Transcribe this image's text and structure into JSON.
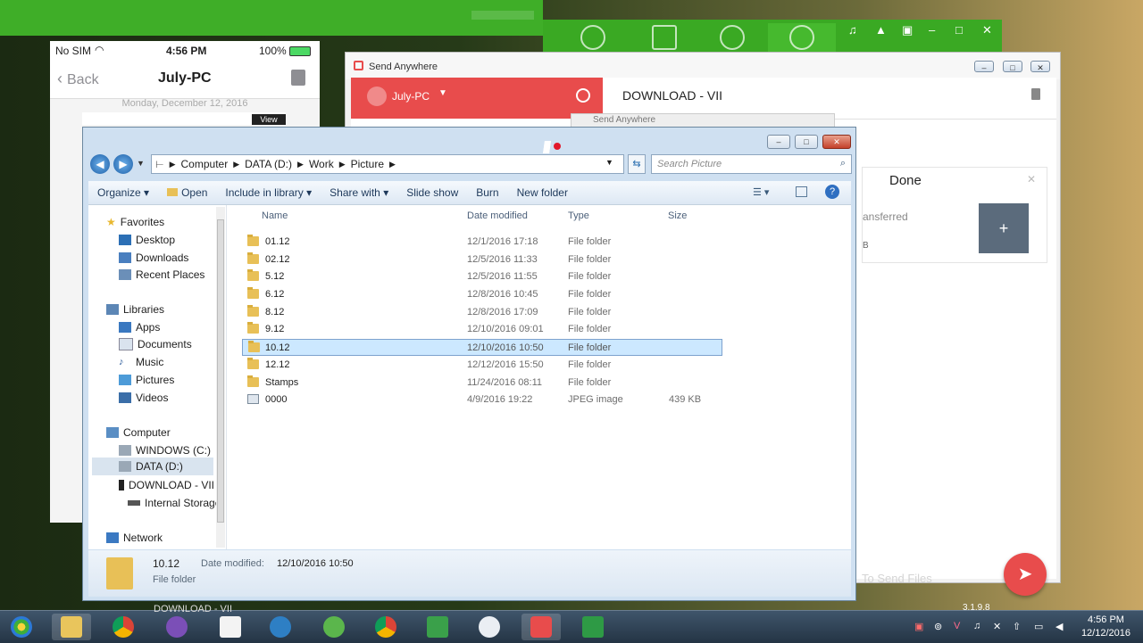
{
  "phone": {
    "carrier": "No SIM",
    "time": "4:56 PM",
    "battery": "100%",
    "back_label": "Back",
    "title": "July-PC",
    "date": "Monday, December 12, 2016",
    "view_label": "View"
  },
  "send_anywhere": {
    "title": "Send Anywhere",
    "device": "July-PC",
    "header": "DOWNLOAD - VII",
    "done_title": "Done",
    "done_status": "ansferred",
    "done_size": "B",
    "footer_hint": "To Send Files",
    "version": "3.1.9.8",
    "ghost_title": "Send Anywhere"
  },
  "explorer": {
    "breadcrumb": [
      "Computer",
      "DATA (D:)",
      "Work",
      "Picture"
    ],
    "search_placeholder": "Search Picture",
    "toolbar": {
      "organize": "Organize",
      "open": "Open",
      "include": "Include in library",
      "share": "Share with",
      "slideshow": "Slide show",
      "burn": "Burn",
      "new_folder": "New folder"
    },
    "nav": {
      "favorites": "Favorites",
      "desktop": "Desktop",
      "downloads": "Downloads",
      "recent": "Recent Places",
      "libraries": "Libraries",
      "apps": "Apps",
      "documents": "Documents",
      "music": "Music",
      "pictures": "Pictures",
      "videos": "Videos",
      "computer": "Computer",
      "windows_c": "WINDOWS (C:)",
      "data_d": "DATA (D:)",
      "download_vii": "DOWNLOAD - VII",
      "internal": "Internal Storage",
      "network": "Network"
    },
    "columns": {
      "name": "Name",
      "date": "Date modified",
      "type": "Type",
      "size": "Size"
    },
    "files": [
      {
        "name": "01.12",
        "date": "12/1/2016 17:18",
        "type": "File folder",
        "size": ""
      },
      {
        "name": "02.12",
        "date": "12/5/2016 11:33",
        "type": "File folder",
        "size": ""
      },
      {
        "name": "5.12",
        "date": "12/5/2016 11:55",
        "type": "File folder",
        "size": ""
      },
      {
        "name": "6.12",
        "date": "12/8/2016 10:45",
        "type": "File folder",
        "size": ""
      },
      {
        "name": "8.12",
        "date": "12/8/2016 17:09",
        "type": "File folder",
        "size": ""
      },
      {
        "name": "9.12",
        "date": "12/10/2016 09:01",
        "type": "File folder",
        "size": ""
      },
      {
        "name": "10.12",
        "date": "12/10/2016 10:50",
        "type": "File folder",
        "size": ""
      },
      {
        "name": "12.12",
        "date": "12/12/2016 15:50",
        "type": "File folder",
        "size": ""
      },
      {
        "name": "Stamps",
        "date": "11/24/2016 08:11",
        "type": "File folder",
        "size": ""
      },
      {
        "name": "0000",
        "date": "4/9/2016 19:22",
        "type": "JPEG image",
        "size": "439 KB"
      }
    ],
    "status": {
      "name": "10.12",
      "modified_label": "Date modified:",
      "modified_value": "12/10/2016 10:50",
      "type": "File folder"
    }
  },
  "taskbar": {
    "ghost_label": "DOWNLOAD - VII",
    "time": "4:56 PM",
    "date": "12/12/2016"
  },
  "colors": {
    "accent_red": "#e84c4c",
    "green_app": "#3fae28",
    "selection": "#cce8ff"
  }
}
